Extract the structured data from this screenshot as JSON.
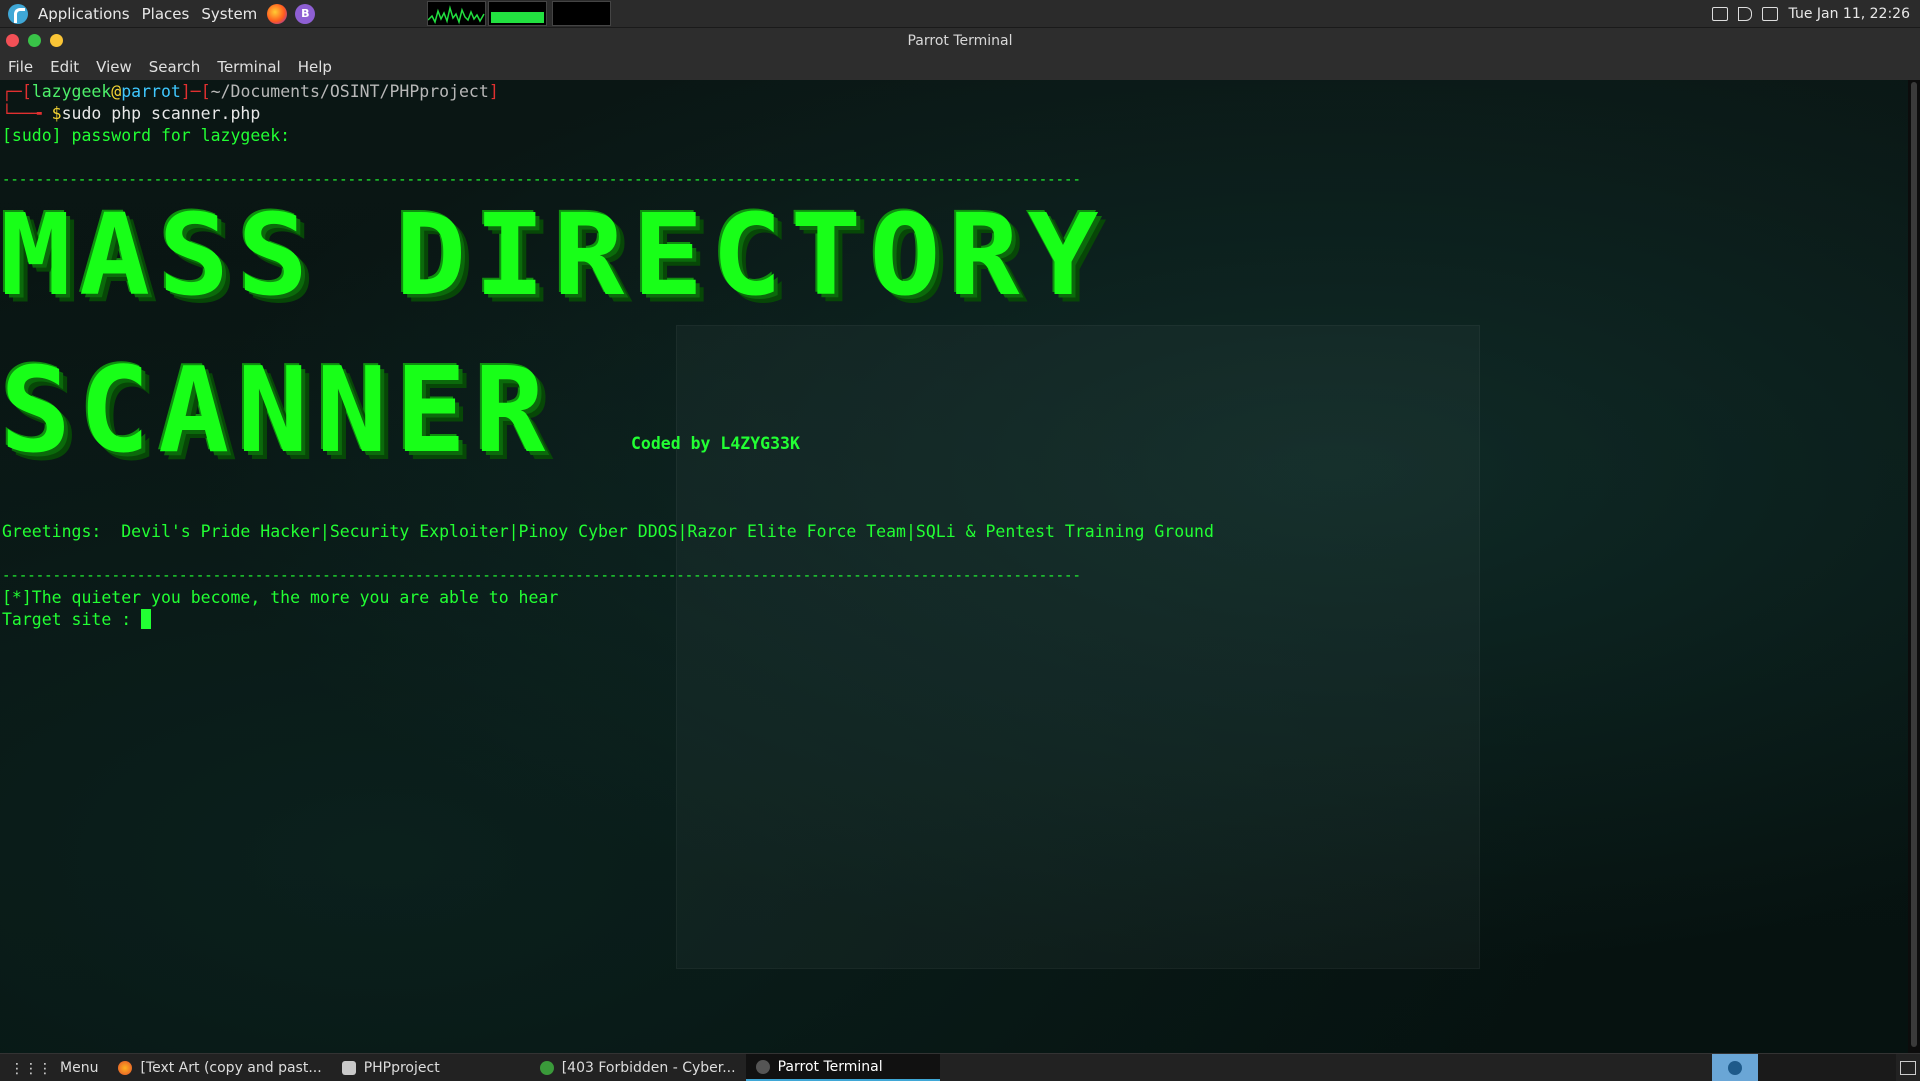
{
  "top_panel": {
    "applications": "Applications",
    "places": "Places",
    "system": "System",
    "clock": "Tue Jan 11, 22:26"
  },
  "window": {
    "title": "Parrot Terminal",
    "menu": [
      "File",
      "Edit",
      "View",
      "Search",
      "Terminal",
      "Help"
    ]
  },
  "terminal": {
    "prompt_bracket_open": "┌─[",
    "user": "lazygeek",
    "at": "@",
    "host": "parrot",
    "sep": "]─[",
    "path": "~/Documents/OSINT/PHPproject",
    "bracket_close": "]",
    "prompt_prefix": "└──╼ ",
    "prompt_symbol": "$",
    "command": "sudo php scanner.php",
    "sudo_line": "[sudo] password for lazygeek:",
    "divider": "--------------------------------------------------------------------------------------------------------------------------------",
    "banner_line1": "MASS DIRECTORY",
    "banner_line2": "SCANNER",
    "coded_by": "Coded by L4ZYG33K",
    "greetings": "Greetings:  Devil's Pride Hacker|Security Exploiter|Pinoy Cyber DDOS|Razor Elite Force Team|SQLi & Pentest Training Ground",
    "quiet_line": "[*]The quieter you become, the more you are able to hear",
    "target_prompt": "Target site : "
  },
  "taskbar": {
    "menu": "Menu",
    "items": [
      {
        "label": "[Text Art (copy and past..."
      },
      {
        "label": "PHPproject"
      },
      {
        "label": "[403 Forbidden - Cyber..."
      },
      {
        "label": "Parrot Terminal"
      }
    ]
  }
}
